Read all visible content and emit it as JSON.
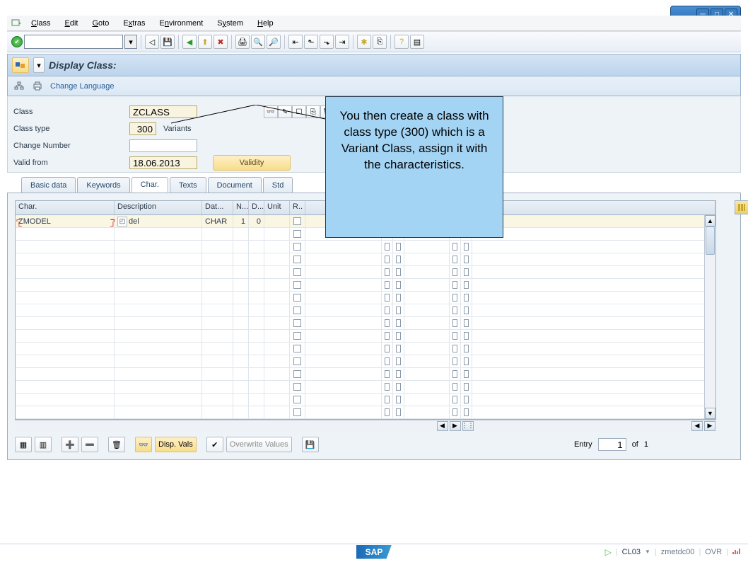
{
  "window": {
    "title": ""
  },
  "menu": [
    "Class",
    "Edit",
    "Goto",
    "Extras",
    "Environment",
    "System",
    "Help"
  ],
  "menu_hotkeys": [
    "C",
    "E",
    "G",
    "x",
    "n",
    "y",
    "H"
  ],
  "title_header": "Display Class:",
  "secbar": {
    "link": "Change Language"
  },
  "form": {
    "class_label": "Class",
    "class_value": "ZCLASS",
    "classtype_label": "Class type",
    "classtype_value": "300",
    "classtype_text": "Variants",
    "changeno_label": "Change Number",
    "changeno_value": "",
    "validfrom_label": "Valid from",
    "validfrom_value": "18.06.2013",
    "validity_btn": "Validity"
  },
  "callout_text": "You then create a class with class type (300) which is a Variant Class, assign it with the characteristics.",
  "tabs": [
    "Basic data",
    "Keywords",
    "Char.",
    "Texts",
    "Document",
    "Std"
  ],
  "active_tab": 2,
  "table": {
    "headers": {
      "char": "Char.",
      "desc": "Description",
      "dat": "Dat...",
      "n": "N...",
      "d": "D...",
      "unit": "Unit",
      "r": "R.."
    },
    "rows": [
      {
        "char": "ZMODEL",
        "desc": "del",
        "dat": "CHAR",
        "n": "1",
        "d": "0",
        "unit": "",
        "r": false
      }
    ],
    "empty_rows": 15
  },
  "bottom": {
    "disp_vals": "Disp. Vals",
    "overwrite": "Overwrite Values",
    "entry_label": "Entry",
    "entry_value": "1",
    "of_label": "of",
    "total": "1"
  },
  "status": {
    "transaction": "CL03",
    "system": "zmetdc00",
    "mode": "OVR",
    "sap": "SAP"
  }
}
